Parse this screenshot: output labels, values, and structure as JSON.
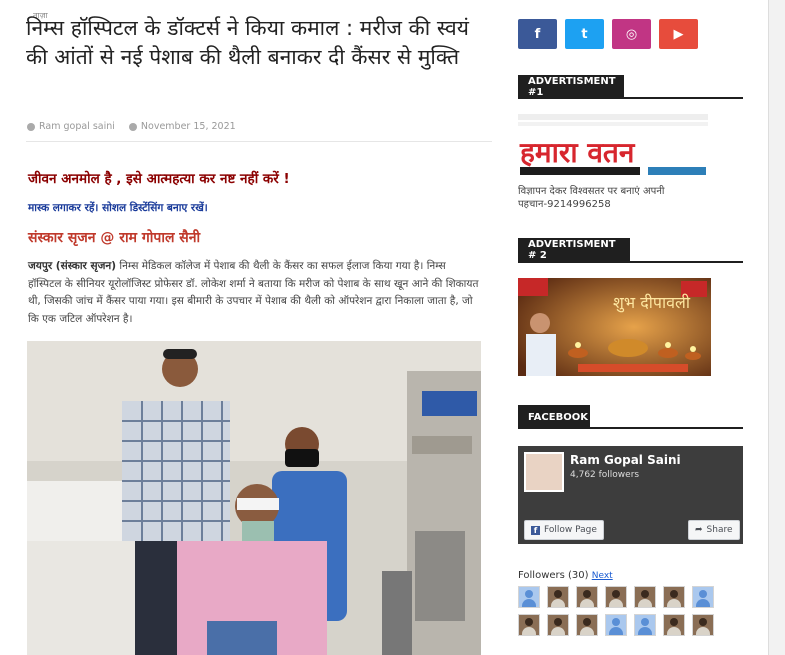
{
  "article": {
    "tag": "ताज़ा",
    "title": "निम्स हॉस्पिटल के डॉक्टर्स ने किया कमाल : मरीज की स्वयं की आंतों से नई पेशाब की थैली बनाकर दी कैंसर से मुक्ति",
    "author": "Ram gopal saini",
    "date": "November 15, 2021",
    "tagline1": "जीवन अनमोल है , इसे आत्महत्या कर नष्ट नहीं करें !",
    "tagline2": "मास्क लगाकर रहें। सोशल डिस्टेंसिंग बनाए रखें।",
    "byline": "संस्कार सृजन @ राम गोपाल सैनी",
    "dateline": "जयपुर (संस्कार सृजन)",
    "body": "निम्स मेडिकल कॉलेज में पेशाब की थैली के कैंसर का सफल ईलाज किया गया है। निम्स हॉस्पिटल के सीनियर यूरोलॉजिस्ट प्रोफेसर डॉ. लोकेश शर्मा ने बताया कि मरीज को पेशाब के साथ खून आने की शिकायत थी, जिसकी जांच में कैंसर पाया गया। इस बीमारी के उपचार में पेशाब की थैली को ऑपरेशन द्वारा निकाला जाता है, जो कि एक जटिल ऑपरेशन है।"
  },
  "sidebar": {
    "social": [
      {
        "icon": "facebook-icon",
        "glyph": "f",
        "color": "#3b5998"
      },
      {
        "icon": "twitter-icon",
        "glyph": "t",
        "color": "#1da1f2"
      },
      {
        "icon": "instagram-icon",
        "glyph": "◎",
        "color": "#c13584"
      },
      {
        "icon": "youtube-icon",
        "glyph": "▶",
        "color": "#e74c3c"
      }
    ],
    "ad1_heading": "ADVERTISMENT #1",
    "ad1_brand": "हमारा वतन",
    "ad1_text": "विज्ञापन देकर विश्वसतर पर बनाएं अपनी पहचान-9214996258",
    "ad2_heading": "ADVERTISMENT # 2",
    "ad2_text": "शुभ दीपावली",
    "facebook_heading": "FACEBOOK",
    "fb_page_name": "Ram Gopal Saini",
    "fb_followers": "4,762 followers",
    "fb_follow_button": "Follow Page",
    "fb_share_button": "Share",
    "followers_label": "Followers (30)",
    "followers_next": "Next"
  },
  "colors": {
    "accent_dark": "#1f1f1f",
    "tagline_red": "#8b0000",
    "tagline_blue": "#1a3b9a",
    "byline_red": "#c0392b"
  }
}
